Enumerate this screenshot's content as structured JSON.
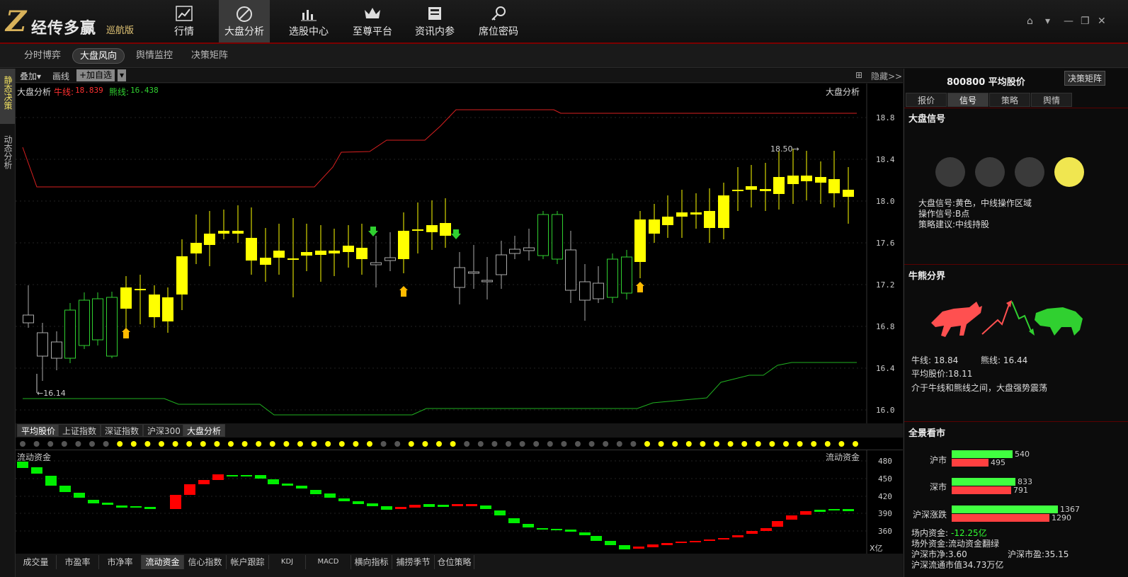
{
  "app": {
    "logo_text": "经传多赢",
    "logo_sub": "巡航版"
  },
  "nav": [
    {
      "label": "行情",
      "icon": "chart-up-icon"
    },
    {
      "label": "大盘分析",
      "icon": "compass-icon",
      "active": true
    },
    {
      "label": "选股中心",
      "icon": "bar-chart-icon"
    },
    {
      "label": "至尊平台",
      "icon": "crown-icon"
    },
    {
      "label": "资讯内参",
      "icon": "document-icon"
    },
    {
      "label": "席位密码",
      "icon": "key-icon"
    }
  ],
  "subtabs": [
    {
      "label": "分时博弈"
    },
    {
      "label": "大盘风向",
      "active": true
    },
    {
      "label": "舆情监控"
    },
    {
      "label": "决策矩阵"
    }
  ],
  "left_side": [
    {
      "label": "静态决策",
      "active": true
    },
    {
      "label": "动态分析"
    }
  ],
  "chart_toolbar": {
    "overlay": "叠加▾",
    "draw": "画线",
    "add_watch": "+加自选",
    "hide": "隐藏>>"
  },
  "main_chart": {
    "title": "大盘分析",
    "bull_label": "牛线:",
    "bull_value": "18.839",
    "bear_label": "熊线:",
    "bear_value": "16.438",
    "right_title": "大盘分析",
    "high_note": "18.50→",
    "low_note": "←16.14",
    "y_ticks": [
      "18.8",
      "18.4",
      "18.0",
      "17.6",
      "17.2",
      "16.8",
      "16.4",
      "16.0"
    ]
  },
  "index_tabs": [
    {
      "label": "平均股价",
      "active": true
    },
    {
      "label": "上证指数"
    },
    {
      "label": "深证指数"
    },
    {
      "label": "沪深300"
    },
    {
      "label": "大盘分析",
      "active": true
    }
  ],
  "flow_chart": {
    "title": "流动资金",
    "right_title": "流动资金",
    "y_ticks": [
      "480",
      "450",
      "420",
      "390",
      "360"
    ],
    "unit": "X亿"
  },
  "bottom_tabs": [
    {
      "label": "成交量"
    },
    {
      "label": "市盈率"
    },
    {
      "label": "市净率"
    },
    {
      "label": "流动资金",
      "active": true
    },
    {
      "label": "信心指数"
    },
    {
      "label": "帐户跟踪"
    },
    {
      "label": "KDJ"
    },
    {
      "label": "MACD"
    },
    {
      "label": "横向指标"
    },
    {
      "label": "捕捞季节"
    },
    {
      "label": "仓位策略"
    }
  ],
  "right_panel": {
    "header": "800800 平均股价",
    "header_btn": "决策矩阵",
    "tabs": [
      {
        "label": "报价"
      },
      {
        "label": "信号",
        "active": true
      },
      {
        "label": "策略"
      },
      {
        "label": "舆情"
      }
    ],
    "signal_title": "大盘信号",
    "signal_lines": [
      "大盘信号:黄色，中线操作区域",
      "操作信号:B点",
      "策略建议:中线持股"
    ],
    "bullbear_title": "牛熊分界",
    "bull_line": "牛线: 18.84",
    "bear_line": "熊线: 16.44",
    "avg_price": "平均股价:18.11",
    "comment": "介于牛线和熊线之间，大盘强势震荡",
    "overview_title": "全景看市",
    "markets": [
      {
        "label": "沪市",
        "up": "540",
        "down": "495"
      },
      {
        "label": "深市",
        "up": "833",
        "down": "791"
      },
      {
        "label": "沪深涨跌",
        "up": "1367",
        "down": "1290"
      }
    ],
    "fund_in_label": "场内资金:",
    "fund_in_value": "-12.25亿",
    "fund_out": "场外资金:流动资金翻绿",
    "sh_pb": "沪深市净:3.60",
    "sh_pe": "沪深市盈:35.15",
    "float_cap": "沪深流通市值34.73万亿"
  },
  "colors": {
    "bull": "#ff3030",
    "bear": "#30d030",
    "yellow": "#ffff00",
    "accent": "#7a0000"
  }
}
